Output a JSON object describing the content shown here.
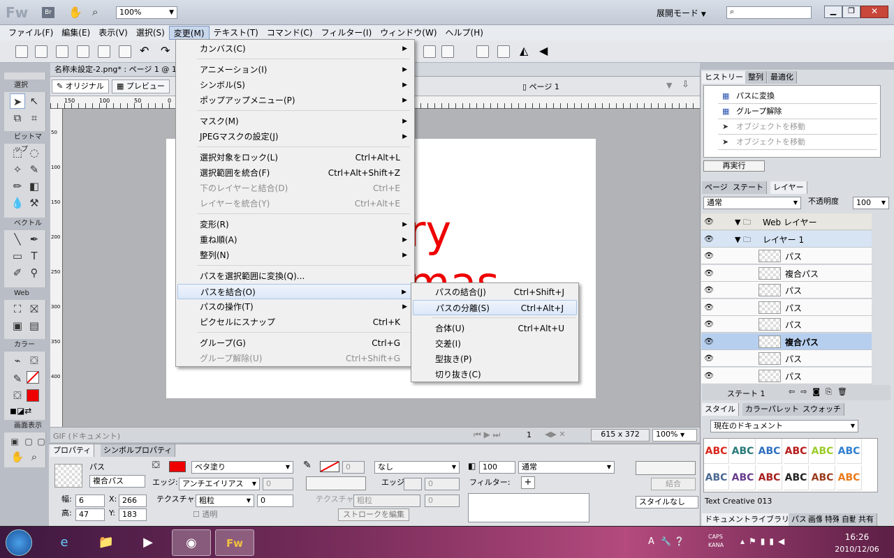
{
  "app": {
    "logo": "Fw",
    "br": "Br",
    "zoom": "100%",
    "workspace": "展開モード",
    "search_placeholder": ""
  },
  "menubar": [
    "ファイル(F)",
    "編集(E)",
    "表示(V)",
    "選択(S)",
    "変更(M)",
    "テキスト(T)",
    "コマンド(C)",
    "フィルター(I)",
    "ウィンドウ(W)",
    "ヘルプ(H)"
  ],
  "tools": {
    "sections": [
      "選択",
      "ビットマップ",
      "ベクトル",
      "Web",
      "カラー",
      "画面表示"
    ]
  },
  "doc": {
    "tab": "名称未設定-2.png* : ページ 1 @ 1",
    "original": "オリジナル",
    "preview": "プレビュー",
    "page": "ページ 1"
  },
  "ruler_top": [
    "150",
    "100",
    "50",
    "0"
  ],
  "ruler_left": [
    "50",
    "100",
    "150",
    "200",
    "250",
    "300",
    "350",
    "400"
  ],
  "canvas_text": [
    "ry",
    "mas"
  ],
  "status": {
    "format": "GIF (ドキュメント)",
    "page_num": "1",
    "size": "615 x 372",
    "zoom": "100%"
  },
  "menu": {
    "items": [
      {
        "label": "カンバス(C)",
        "shortcut": "",
        "sub": true,
        "disabled": false
      },
      {
        "sep": true
      },
      {
        "label": "アニメーション(I)",
        "shortcut": "",
        "sub": true,
        "disabled": false
      },
      {
        "label": "シンボル(S)",
        "shortcut": "",
        "sub": true,
        "disabled": false
      },
      {
        "label": "ポップアップメニュー(P)",
        "shortcut": "",
        "sub": true,
        "disabled": false
      },
      {
        "sep": true
      },
      {
        "label": "マスク(M)",
        "shortcut": "",
        "sub": true,
        "disabled": false
      },
      {
        "label": "JPEGマスクの設定(J)",
        "shortcut": "",
        "sub": true,
        "disabled": false
      },
      {
        "sep": true
      },
      {
        "label": "選択対象をロック(L)",
        "shortcut": "Ctrl+Alt+L",
        "sub": false,
        "disabled": false
      },
      {
        "label": "選択範囲を統合(F)",
        "shortcut": "Ctrl+Alt+Shift+Z",
        "sub": false,
        "disabled": false
      },
      {
        "label": "下のレイヤーと結合(D)",
        "shortcut": "Ctrl+E",
        "sub": false,
        "disabled": true
      },
      {
        "label": "レイヤーを統合(Y)",
        "shortcut": "Ctrl+Alt+E",
        "sub": false,
        "disabled": true
      },
      {
        "sep": true
      },
      {
        "label": "変形(R)",
        "shortcut": "",
        "sub": true,
        "disabled": false
      },
      {
        "label": "重ね順(A)",
        "shortcut": "",
        "sub": true,
        "disabled": false
      },
      {
        "label": "整列(N)",
        "shortcut": "",
        "sub": true,
        "disabled": false
      },
      {
        "sep": true
      },
      {
        "label": "パスを選択範囲に変換(Q)...",
        "shortcut": "",
        "sub": false,
        "disabled": false
      },
      {
        "label": "パスを結合(O)",
        "shortcut": "",
        "sub": true,
        "disabled": false,
        "highlight": true
      },
      {
        "label": "パスの操作(T)",
        "shortcut": "",
        "sub": true,
        "disabled": false
      },
      {
        "label": "ピクセルにスナップ",
        "shortcut": "Ctrl+K",
        "sub": false,
        "disabled": false
      },
      {
        "sep": true
      },
      {
        "label": "グループ(G)",
        "shortcut": "Ctrl+G",
        "sub": false,
        "disabled": false
      },
      {
        "label": "グループ解除(U)",
        "shortcut": "Ctrl+Shift+G",
        "sub": false,
        "disabled": true
      }
    ]
  },
  "submenu": {
    "items": [
      {
        "label": "パスの結合(J)",
        "shortcut": "Ctrl+Shift+J"
      },
      {
        "label": "パスの分離(S)",
        "shortcut": "Ctrl+Alt+J",
        "highlight": true
      },
      {
        "sep": true
      },
      {
        "label": "合体(U)",
        "shortcut": "Ctrl+Alt+U"
      },
      {
        "label": "交差(I)",
        "shortcut": ""
      },
      {
        "label": "型抜き(P)",
        "shortcut": ""
      },
      {
        "label": "切り抜き(C)",
        "shortcut": ""
      }
    ]
  },
  "props": {
    "tabs": [
      "プロパティ",
      "シンボルプロパティ"
    ],
    "obj_type": "パス",
    "obj_name": "複合パス",
    "w_label": "幅:",
    "w": "6",
    "h_label": "高:",
    "h": "47",
    "x_label": "X:",
    "x": "266",
    "y_label": "Y:",
    "y": "183",
    "fill_type": "ベタ塗り",
    "edge_label": "エッジ:",
    "edge": "アンチエイリアス",
    "edge_val": "0",
    "texture_label": "テクスチャ:",
    "texture": "粗粒",
    "texture_val": "0",
    "transparent": "透明",
    "stroke_val": "0",
    "stroke_type": "なし",
    "stroke_edge_label": "エッジ:",
    "stroke_edge_val": "0",
    "stroke_texture_label": "テクスチャ:",
    "stroke_texture": "粗粒",
    "stroke_texture_val": "0",
    "edit_stroke": "ストロークを編集",
    "opacity": "100",
    "blend": "通常",
    "filter_label": "フィルター:",
    "combine": "結合",
    "style": "スタイルなし"
  },
  "history": {
    "tabs": [
      "ヒストリー",
      "整列",
      "最適化"
    ],
    "items": [
      {
        "label": "パスに変換",
        "dim": false
      },
      {
        "label": "グループ解除",
        "dim": false
      },
      {
        "label": "オブジェクトを移動",
        "dim": true
      },
      {
        "label": "オブジェクトを移動",
        "dim": true
      }
    ],
    "replay": "再実行"
  },
  "layers": {
    "tabs": [
      "ページ",
      "ステート",
      "レイヤー"
    ],
    "blend": "通常",
    "opacity_label": "不透明度",
    "opacity": "100",
    "rows": [
      {
        "name": "Web レイヤー",
        "type": "folder",
        "indent": 0
      },
      {
        "name": "レイヤー 1",
        "type": "folder",
        "indent": 0,
        "active": true
      },
      {
        "name": "パス",
        "type": "item",
        "indent": 1
      },
      {
        "name": "複合パス",
        "type": "item",
        "indent": 1
      },
      {
        "name": "パス",
        "type": "item",
        "indent": 1
      },
      {
        "name": "パス",
        "type": "item",
        "indent": 1
      },
      {
        "name": "パス",
        "type": "item",
        "indent": 1
      },
      {
        "name": "複合パス",
        "type": "item",
        "indent": 1,
        "selected": true
      },
      {
        "name": "パス",
        "type": "item",
        "indent": 1
      },
      {
        "name": "パス",
        "type": "item",
        "indent": 1
      }
    ],
    "state": "ステート 1"
  },
  "styles": {
    "tabs": [
      "スタイル",
      "カラーパレット",
      "スウォッチ"
    ],
    "source": "現在のドキュメント",
    "label": "ABC",
    "row1": [
      "#d9261c",
      "#2b7a7a",
      "#2f6fc0",
      "#b81a1a",
      "#9ccc2a",
      "#2f7fcf"
    ],
    "row2": [
      "#4a6890",
      "#6a3d8c",
      "#a82020",
      "#222222",
      "#9a3c1e",
      "#e87a1a"
    ],
    "caption": "Text Creative 013"
  },
  "doclib": {
    "tabs": [
      "ドキュメントライブラリ",
      "パス",
      "画像",
      "特殊",
      "自動",
      "共有"
    ]
  },
  "taskbar": {
    "time": "16:26",
    "date": "2010/12/06",
    "caps": "CAPS",
    "kana": "KANA",
    "ime": "A"
  }
}
